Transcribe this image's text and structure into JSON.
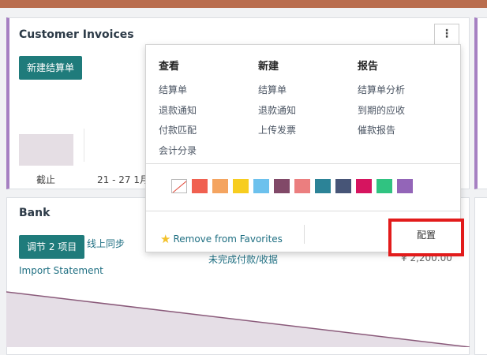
{
  "invoices": {
    "title": "Customer Invoices",
    "new_button": "新建结算单",
    "axis": {
      "due_label": "截止",
      "range_label": "21 - 27 1月"
    }
  },
  "bank": {
    "title": "Bank",
    "reconcile_button": "调节 2 项目",
    "sync_text": "线上同步",
    "import_link": "Import Statement",
    "pending_label": "未完成付款/收据",
    "pending_amount": "¥ 2,200.00"
  },
  "dropdown": {
    "columns": [
      {
        "heading": "查看",
        "items": [
          "结算单",
          "退款通知",
          "付款匹配",
          "会计分录"
        ]
      },
      {
        "heading": "新建",
        "items": [
          "结算单",
          "退款通知",
          "上传发票"
        ]
      },
      {
        "heading": "报告",
        "items": [
          "结算单分析",
          "到期的应收",
          "催款报告"
        ]
      }
    ],
    "colors": [
      "none",
      "#f06050",
      "#f4a460",
      "#f7cd1f",
      "#6cc1ed",
      "#814968",
      "#eb7e7f",
      "#2c8397",
      "#475577",
      "#d6145f",
      "#30c381",
      "#9365b8"
    ],
    "remove_favorites": "Remove from Favorites",
    "configure": "配置"
  },
  "icons": {
    "kebab": "kebab-menu-icon",
    "star": "star-icon"
  }
}
